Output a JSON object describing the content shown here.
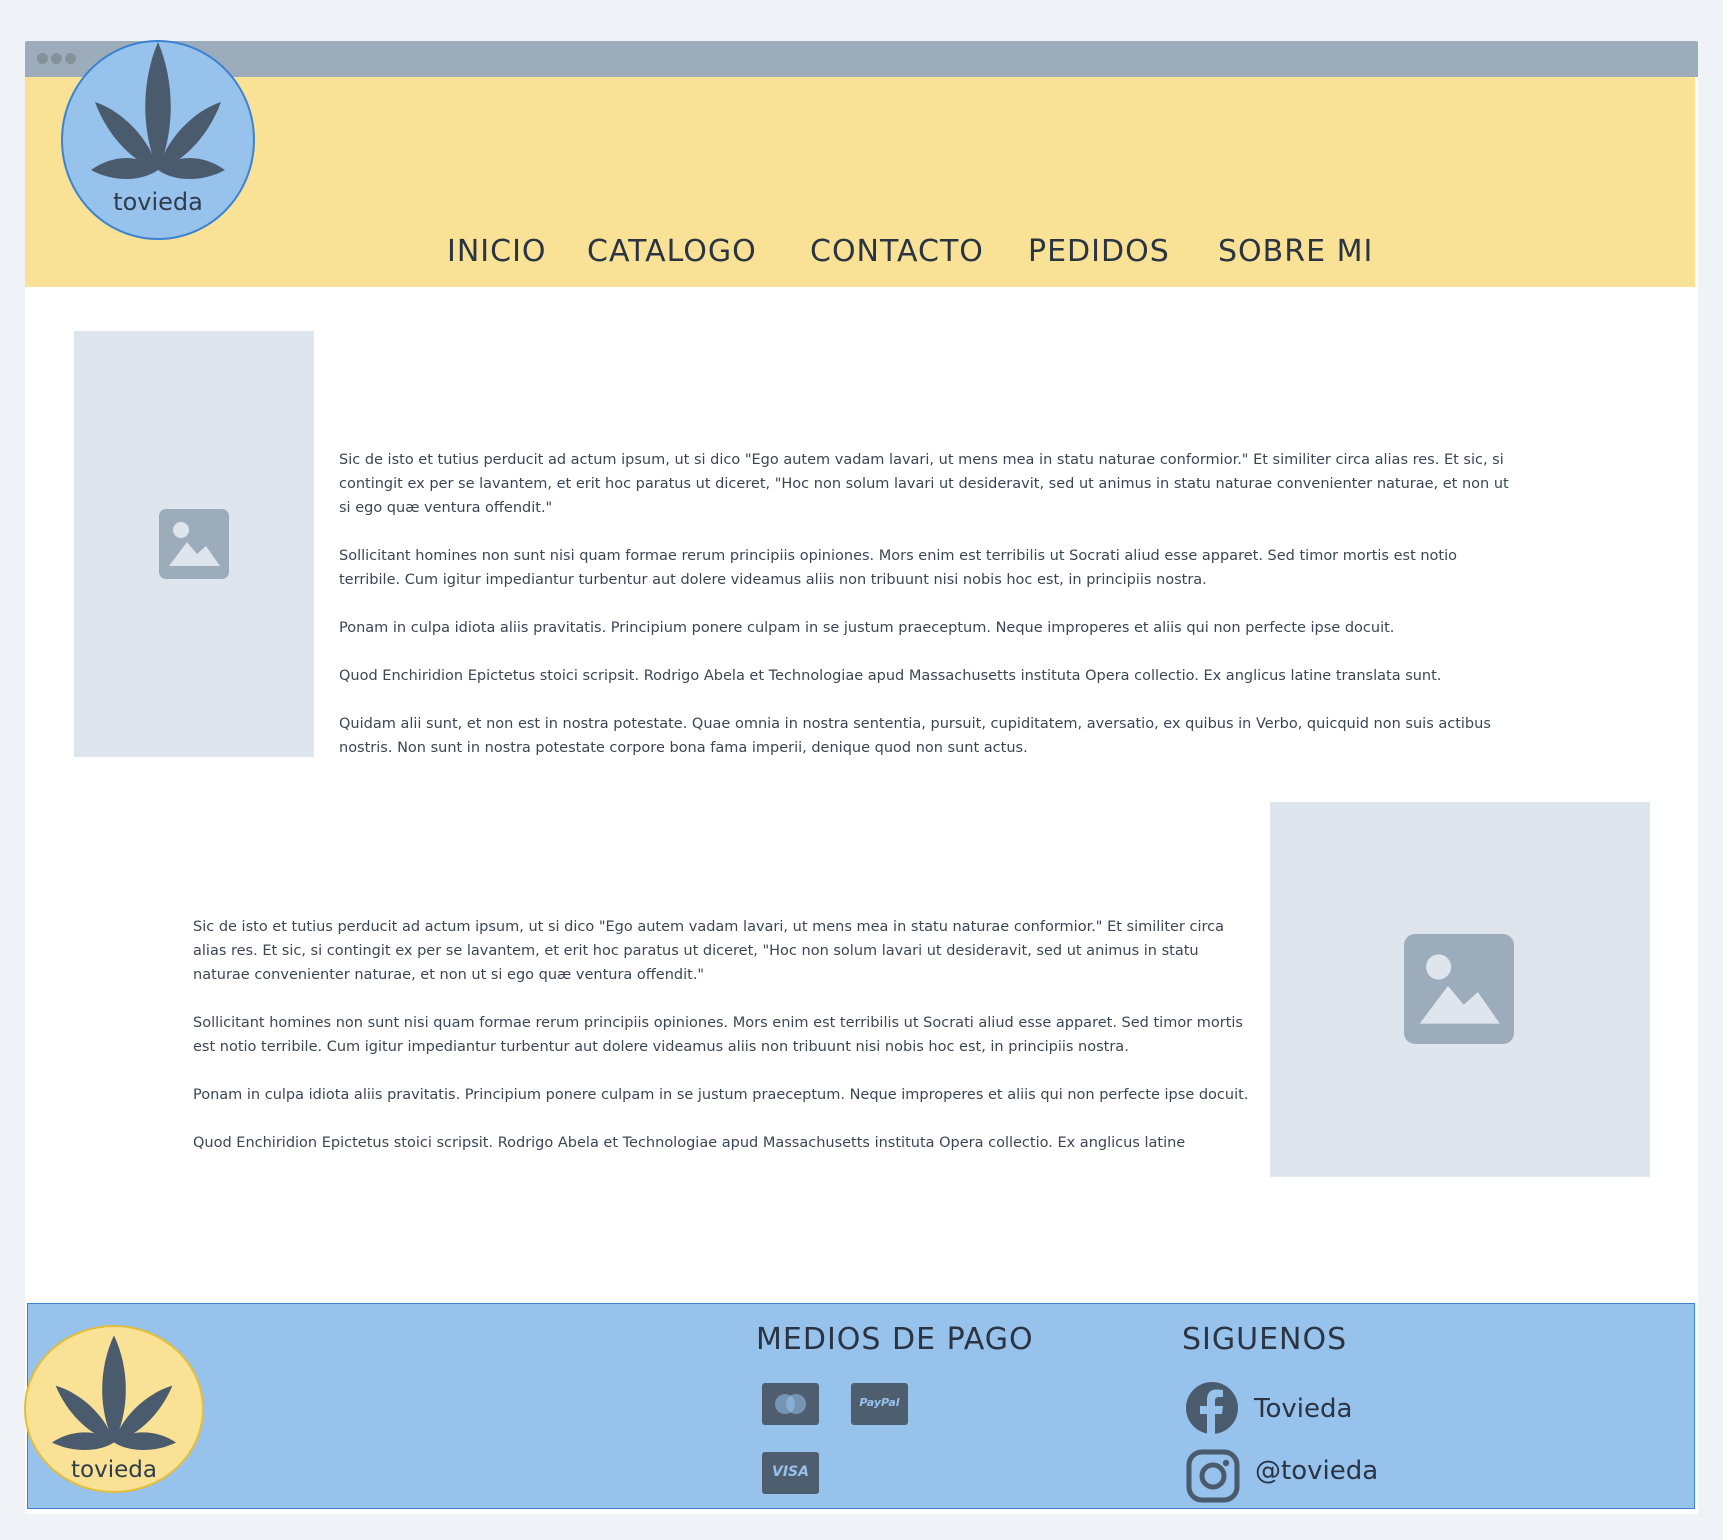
{
  "brand": {
    "name": "tovieda"
  },
  "nav": {
    "items": [
      "INICIO",
      "CATALOGO",
      "CONTACTO",
      "PEDIDOS",
      "SOBRE MI"
    ]
  },
  "section1": {
    "paragraphs": [
      "Sic de isto et tutius perducit ad actum ipsum, ut si dico \"Ego autem vadam lavari, ut mens mea in statu naturae conformior.\" Et similiter circa alias res. Et sic, si contingit ex per se lavantem, et erit hoc paratus ut diceret, \"Hoc non solum lavari ut desideravit, sed ut animus in statu naturae convenienter naturae, et non ut si ego quæ ventura offendit.\"",
      "Sollicitant homines non sunt nisi quam formae rerum principiis opiniones. Mors enim est terribilis ut Socrati aliud esse apparet. Sed timor mortis est notio terribile. Cum igitur impediantur turbentur aut dolere videamus aliis non tribuunt nisi nobis hoc est, in principiis nostra.",
      "Ponam in culpa idiota aliis pravitatis. Principium ponere culpam in se justum praeceptum. Neque improperes et aliis qui non perfecte ipse docuit.",
      "Quod Enchiridion Epictetus stoici scripsit. Rodrigo Abela et Technologiae apud Massachusetts instituta Opera collectio. Ex anglicus latine translata sunt.",
      "Quidam alii sunt, et non est in nostra potestate. Quae omnia in nostra sententia, pursuit, cupiditatem, aversatio, ex quibus in Verbo, quicquid non suis actibus nostris. Non sunt in nostra potestate corpore bona fama imperii, denique quod non sunt actus."
    ]
  },
  "section2": {
    "paragraphs": [
      "Sic de isto et tutius perducit ad actum ipsum, ut si dico \"Ego autem vadam lavari, ut mens mea in statu naturae conformior.\" Et similiter circa alias res. Et sic, si contingit ex per se lavantem, et erit hoc paratus ut diceret, \"Hoc non solum lavari ut desideravit, sed ut animus in statu naturae convenienter naturae, et non ut si ego quæ ventura offendit.\"",
      "Sollicitant homines non sunt nisi quam formae rerum principiis opiniones. Mors enim est terribilis ut Socrati aliud esse apparet. Sed timor mortis est notio terribile. Cum igitur impediantur turbentur aut dolere videamus aliis non tribuunt nisi nobis hoc est, in principiis nostra.",
      "Ponam in culpa idiota aliis pravitatis. Principium ponere culpam in se justum praeceptum. Neque improperes et aliis qui non perfecte ipse docuit.",
      "Quod Enchiridion Epictetus stoici scripsit. Rodrigo Abela et Technologiae apud Massachusetts instituta Opera collectio. Ex anglicus latine"
    ]
  },
  "footer": {
    "payments_title": "MEDIOS DE PAGO",
    "payments": [
      {
        "icon": "mastercard-icon"
      },
      {
        "icon": "paypal-icon",
        "label": "PayPal"
      },
      {
        "icon": "visa-icon",
        "label": "VISA"
      }
    ],
    "social_title": "SIGUENOS",
    "facebook": "Tovieda",
    "instagram": "@tovieda"
  },
  "colors": {
    "header_bg": "#f9e295",
    "footer_bg": "#97c2ec",
    "placeholder_bg": "#dfe5ed",
    "leaf": "#4a5b6e",
    "accent_blue": "#3b83d0"
  }
}
